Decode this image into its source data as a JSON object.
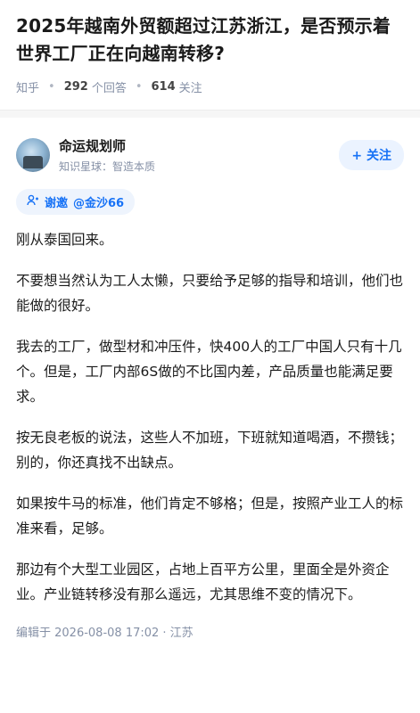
{
  "question": {
    "title": "2025年越南外贸额超过江苏浙江，是否预示着世界工厂正在向越南转移?",
    "source": "知乎",
    "answers_count": "292",
    "answers_label": "个回答",
    "followers_count": "614",
    "followers_label": "关注"
  },
  "author": {
    "name": "命运规划师",
    "desc": "知识星球：智造本质",
    "follow_label": "+ 关注"
  },
  "invite": {
    "label": "谢邀",
    "mention": "@金沙66"
  },
  "answer": {
    "paragraphs": [
      "刚从泰国回来。",
      "不要想当然认为工人太懒，只要给予足够的指导和培训，他们也能做的很好。",
      "我去的工厂，做型材和冲压件，快400人的工厂中国人只有十几个。但是，工厂内部6S做的不比国内差，产品质量也能满足要求。",
      "按无良老板的说法，这些人不加班，下班就知道喝酒，不攒钱；别的，你还真找不出缺点。",
      "如果按牛马的标准，他们肯定不够格；但是，按照产业工人的标准来看，足够。",
      "那边有个大型工业园区，占地上百平方公里，里面全是外资企业。产业链转移没有那么遥远，尤其思维不变的情况下。"
    ],
    "edited": "编辑于 2026-08-08 17:02 · 江苏"
  }
}
